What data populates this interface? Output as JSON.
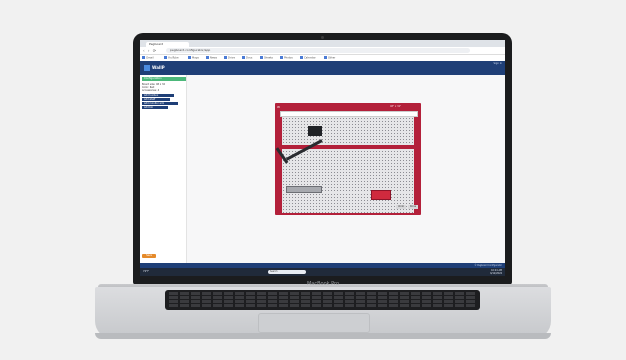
{
  "device": {
    "label": "MacBook Pro"
  },
  "browser": {
    "tab_title": "Pegboard",
    "nav_buttons": "‹ › ⟳",
    "url": "pegboard.configurator/app",
    "bookmarks": [
      "Gmail",
      "YouTube",
      "Maps",
      "News",
      "Drive",
      "Docs",
      "Sheets",
      "Photos",
      "Calendar",
      "Other"
    ]
  },
  "app": {
    "logo_text": "WallP",
    "header_right": "Sign in",
    "menu": [
      "Home",
      "Products",
      "Boards",
      "Accessories",
      "Gallery",
      "Contact",
      "Configurator"
    ],
    "active_menu_index": 6,
    "sidebar": {
      "head": "Configuration",
      "lines": [
        "Board size: 48 x 32",
        "Color: Red",
        "Accessories: 4"
      ],
      "buttons": [
        "Add toolbox",
        "Add shelf",
        "Add monitor arm",
        "Add bin"
      ],
      "orange_button": "Save"
    },
    "board": {
      "tag": "W",
      "size_label": "48\" x 32\"",
      "btn1": "Undo",
      "btn2": "Done"
    },
    "footer_text": "© Pegboard Configurator"
  },
  "taskbar": {
    "weather": "72°F",
    "search_placeholder": "Search",
    "icon_colors": [
      "#3b82f6",
      "#f59e0b",
      "#10b981",
      "#ef4444",
      "#8b5cf6",
      "#14b8a6",
      "#f97316",
      "#22c55e",
      "#eab308",
      "#0ea5e9",
      "#e11d48",
      "#64748b"
    ],
    "clock_time": "10:24 AM",
    "clock_date": "6/12/2024"
  }
}
